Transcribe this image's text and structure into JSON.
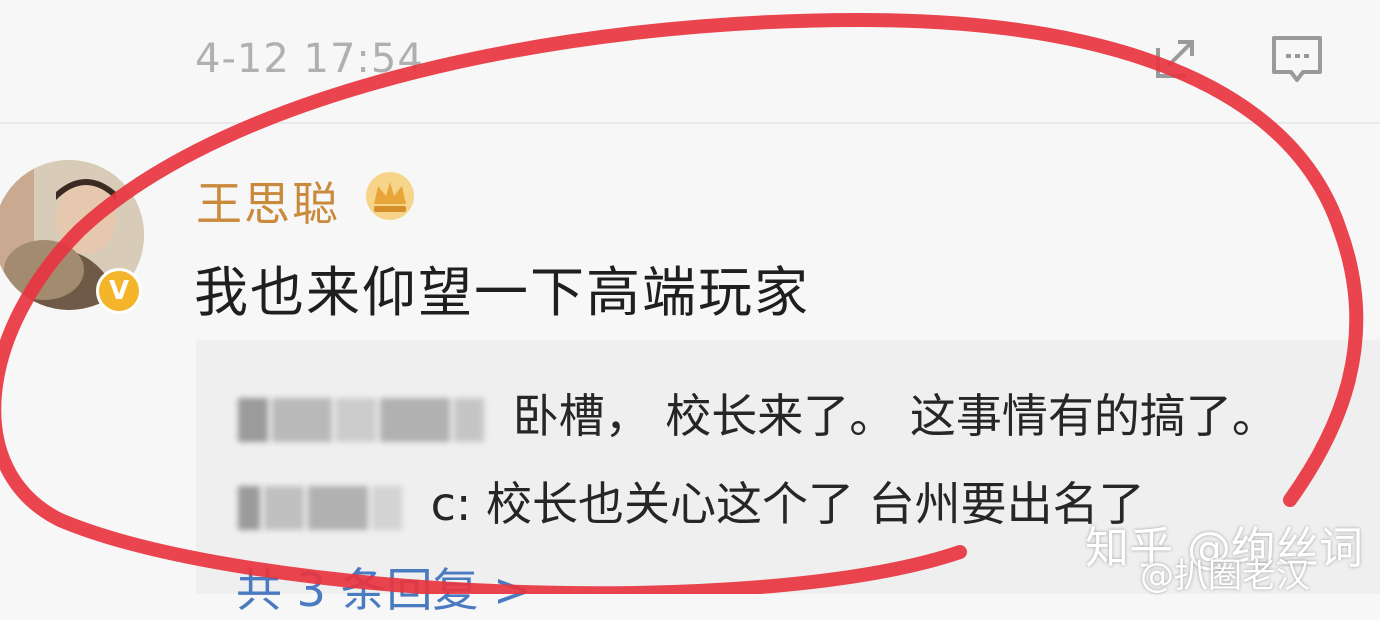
{
  "post": {
    "timestamp": "4-12 17:54"
  },
  "comment": {
    "username": "王思聪",
    "text": "我也来仰望一下高端玩家"
  },
  "replies": [
    {
      "author_suffix": "",
      "text": "卧槽， 校长来了。 这事情有的搞了。"
    },
    {
      "author_suffix": "c:",
      "text": "校长也关心这个了 台州要出名了"
    }
  ],
  "reply_count_label": "共 3 条回复 >",
  "watermark": {
    "line1": "知乎 @绚丝词",
    "line2": "@扒圈老汉"
  },
  "icons": {
    "share": "share-icon",
    "comment": "comment-icon",
    "vip": "crown-vip-icon",
    "verified": "verified-v-icon"
  },
  "colors": {
    "username": "#c98a3c",
    "link": "#4a7ac0",
    "annotation": "#e8343f",
    "badge": "#f4b52a"
  }
}
